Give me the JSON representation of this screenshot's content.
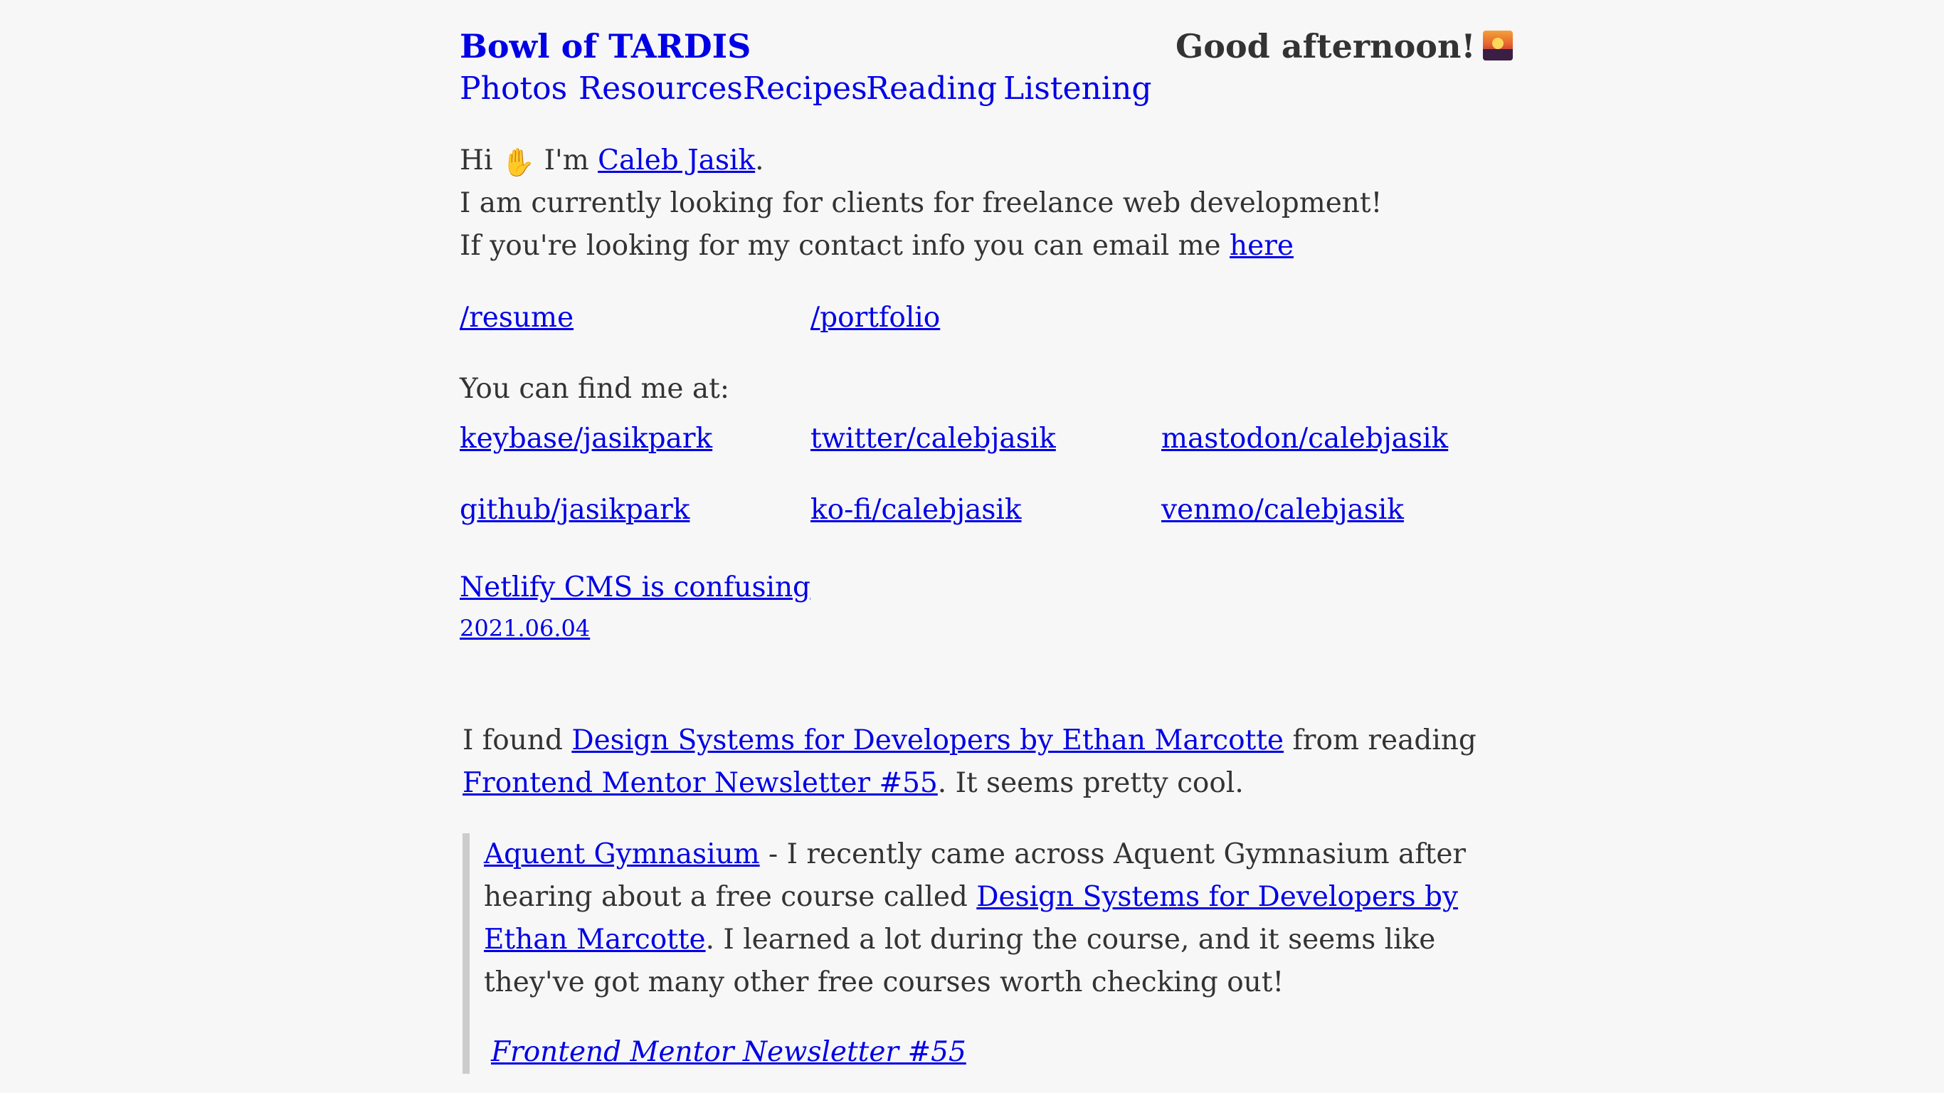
{
  "header": {
    "site_title": "Bowl of TARDIS",
    "greeting": "Good afternoon!",
    "greeting_icon": "sunset-icon"
  },
  "nav": {
    "items": [
      {
        "label": "Photos"
      },
      {
        "label": "Resources"
      },
      {
        "label": "Recipes"
      },
      {
        "label": "Reading"
      },
      {
        "label": "Listening"
      }
    ]
  },
  "intro": {
    "hi": "Hi",
    "wave_icon": "waving-hand-icon",
    "im": "I'm",
    "name_link": "Caleb Jasik",
    "period": ".",
    "line2": "I am currently looking for clients for freelance web development!",
    "line3_text": "If you're looking for my contact info you can email me",
    "line3_link": "here"
  },
  "pages": {
    "resume": "/resume",
    "portfolio": "/portfolio"
  },
  "social": {
    "label": "You can find me at:",
    "row1": [
      "keybase/jasikpark",
      "twitter/calebjasik",
      "mastodon/calebjasik"
    ],
    "row2": [
      "github/jasikpark",
      "ko-fi/calebjasik",
      "venmo/calebjasik"
    ]
  },
  "post": {
    "title": "Netlify CMS is confusing",
    "date": "2021.06.04"
  },
  "found": {
    "t1": "I found",
    "link1": "Design Systems for Developers by Ethan Marcotte",
    "t2": "from reading",
    "link2": "Frontend Mentor Newsletter #55",
    "t3": ". It seems pretty cool."
  },
  "quote": {
    "link1": "Aquent Gymnasium",
    "t1": " - I recently came across Aquent Gymnasium after hearing about a free course called ",
    "link2": "Design Systems for Developers by Ethan Marcotte",
    "t2": ". I learned a lot during the course, and it seems like they've got many other free courses worth checking out!",
    "source": "Frontend Mentor Newsletter #55"
  },
  "colors": {
    "background": "#f7f7f7",
    "text": "#333333",
    "link": "#0000e6",
    "quote_border": "#cccccc"
  }
}
